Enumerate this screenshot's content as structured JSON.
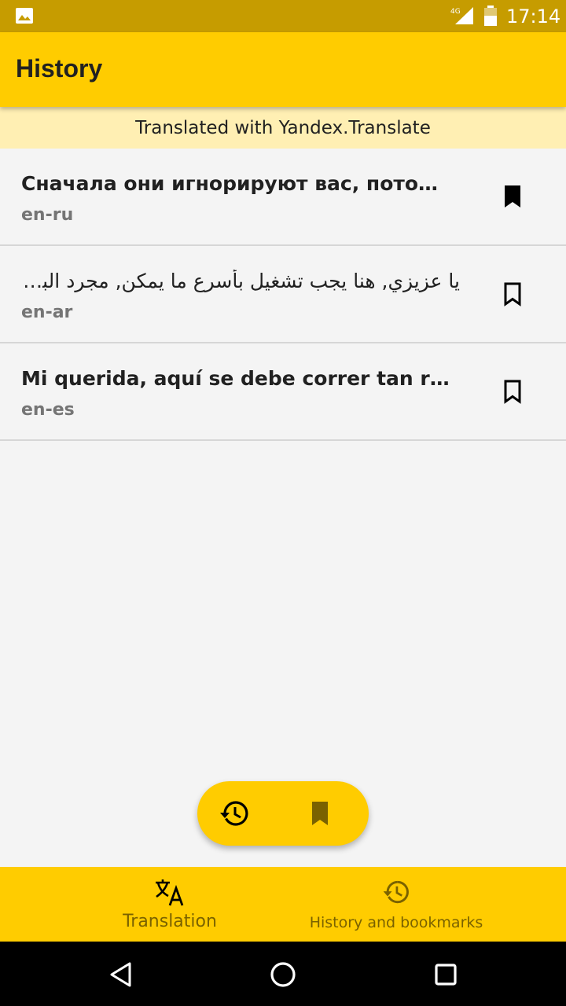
{
  "status_bar": {
    "time": "17:14",
    "network": "4G",
    "icons": [
      "gallery-icon",
      "signal-icon",
      "battery-icon"
    ]
  },
  "app_bar": {
    "title": "History"
  },
  "attribution": "Translated with Yandex.Translate",
  "history": {
    "items": [
      {
        "text": "Сначала они игнорируют вас, потом они…",
        "lang": "en-ru",
        "bookmarked": true,
        "rtl": false
      },
      {
        "text": "يا عزيزي, هنا يجب تشغيل بأسرع ما يمكن, مجرد البقاء …",
        "lang": "en-ar",
        "bookmarked": false,
        "rtl": true
      },
      {
        "text": "Mi querida, aquí se debe correr tan rápido c…",
        "lang": "en-es",
        "bookmarked": false,
        "rtl": false
      }
    ]
  },
  "fab": {
    "history_icon": "history-icon",
    "bookmarks_icon": "bookmark-icon"
  },
  "bottom_nav": {
    "items": [
      {
        "label": "Translation",
        "icon": "translate-icon"
      },
      {
        "label": "History and bookmarks",
        "icon": "history-icon"
      }
    ]
  },
  "colors": {
    "accent": "#ffcc00",
    "status_bar": "#c69c00",
    "attribution_bg": "#ffefb3",
    "nav_label": "#7a6200",
    "background": "#f4f4f4"
  }
}
